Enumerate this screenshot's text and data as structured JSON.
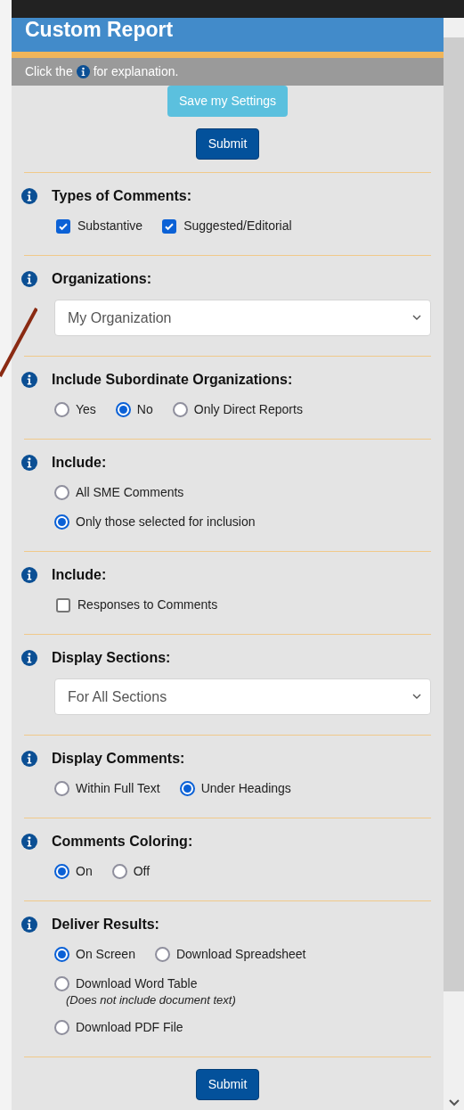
{
  "header": {
    "title": "Custom Report"
  },
  "hint": {
    "before": "Click the",
    "after": "for explanation."
  },
  "top_buttons": [
    {
      "label": "Save my Settings",
      "kind": "secondary"
    },
    {
      "label": "Submit",
      "kind": "primary"
    }
  ],
  "sections": [
    {
      "title": "Types of Comments:",
      "kind": "checkboxes",
      "options": [
        {
          "label": "Substantive",
          "checked": true
        },
        {
          "label": "Suggested/Editorial",
          "checked": true
        }
      ]
    },
    {
      "title": "Organizations:",
      "kind": "select",
      "value": "My Organization"
    },
    {
      "title": "Include Subordinate Organizations:",
      "kind": "radios",
      "rows": [
        [
          {
            "label": "Yes",
            "selected": false
          },
          {
            "label": "No",
            "selected": true
          },
          {
            "label": "Only Direct Reports",
            "selected": false
          }
        ]
      ]
    },
    {
      "title": "Include:",
      "kind": "radios",
      "rows": [
        [
          {
            "label": "All SME Comments",
            "selected": false
          }
        ],
        [
          {
            "label": "Only those selected for inclusion",
            "selected": true
          }
        ]
      ]
    },
    {
      "title": "Include:",
      "kind": "checkboxes",
      "options": [
        {
          "label": "Responses to Comments",
          "checked": false
        }
      ]
    },
    {
      "title": "Display Sections:",
      "kind": "select",
      "value": "For All Sections"
    },
    {
      "title": "Display Comments:",
      "kind": "radios",
      "rows": [
        [
          {
            "label": "Within Full Text",
            "selected": false
          },
          {
            "label": "Under Headings",
            "selected": true
          }
        ]
      ]
    },
    {
      "title": "Comments Coloring:",
      "kind": "radios",
      "rows": [
        [
          {
            "label": "On",
            "selected": true
          },
          {
            "label": "Off",
            "selected": false
          }
        ]
      ]
    },
    {
      "title": "Deliver Results:",
      "kind": "radios",
      "rows": [
        [
          {
            "label": "On Screen",
            "selected": true
          },
          {
            "label": "Download Spreadsheet",
            "selected": false
          }
        ],
        [
          {
            "label": "Download Word Table",
            "selected": false,
            "note": "(Does not include document text)"
          }
        ],
        [
          {
            "label": "Download PDF File",
            "selected": false
          }
        ]
      ]
    }
  ],
  "bottom_button": {
    "label": "Submit"
  }
}
